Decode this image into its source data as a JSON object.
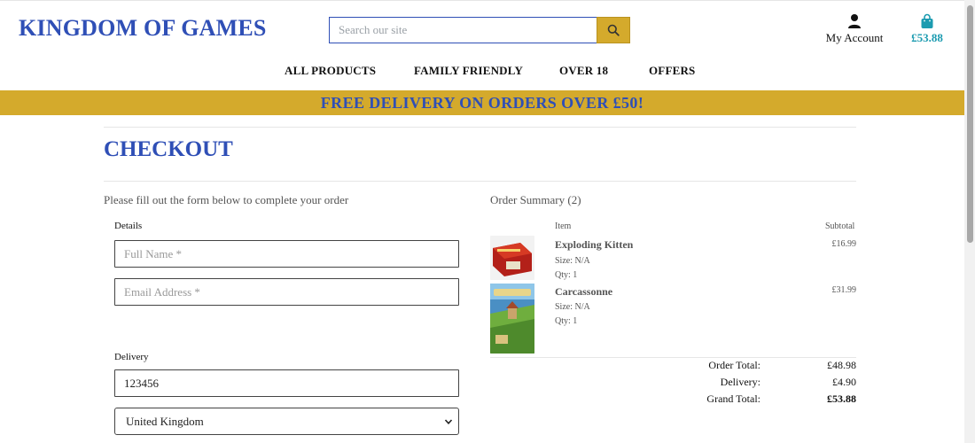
{
  "header": {
    "brand": "KINGDOM OF GAMES",
    "search": {
      "placeholder": "Search our site",
      "icon": "search-icon"
    },
    "account": {
      "label": "My Account",
      "icon": "user-icon"
    },
    "bag": {
      "amount": "£53.88",
      "icon": "shopping-bag-icon",
      "color": "#1b9bb0"
    }
  },
  "nav": {
    "items": [
      "ALL PRODUCTS",
      "FAMILY FRIENDLY",
      "OVER 18",
      "OFFERS"
    ]
  },
  "banner": {
    "text": "FREE DELIVERY ON ORDERS OVER £50!",
    "background": "#d4aa2c",
    "text_color": "#2f4fb6"
  },
  "page": {
    "title": "CHECKOUT",
    "intro": "Please fill out the form below to complete your order"
  },
  "form": {
    "details_label": "Details",
    "full_name": {
      "placeholder": "Full Name *",
      "value": ""
    },
    "email": {
      "placeholder": "Email Address *",
      "value": ""
    },
    "delivery_label": "Delivery",
    "postcode": {
      "value": "123456"
    },
    "country": {
      "selected": "United Kingdom"
    }
  },
  "summary": {
    "title": "Order Summary (2)",
    "col_item": "Item",
    "col_subtotal": "Subtotal",
    "items": [
      {
        "name": "Exploding Kitten",
        "size": "Size: N/A",
        "qty": "Qty: 1",
        "price": "£16.99"
      },
      {
        "name": "Carcassonne",
        "size": "Size: N/A",
        "qty": "Qty: 1",
        "price": "£31.99"
      }
    ],
    "totals": {
      "order_total_label": "Order Total:",
      "order_total": "£48.98",
      "delivery_label": "Delivery:",
      "delivery": "£4.90",
      "grand_total_label": "Grand Total:",
      "grand_total": "£53.88"
    }
  },
  "colors": {
    "brand_blue": "#2f4fb6",
    "gold": "#d4aa2c"
  }
}
